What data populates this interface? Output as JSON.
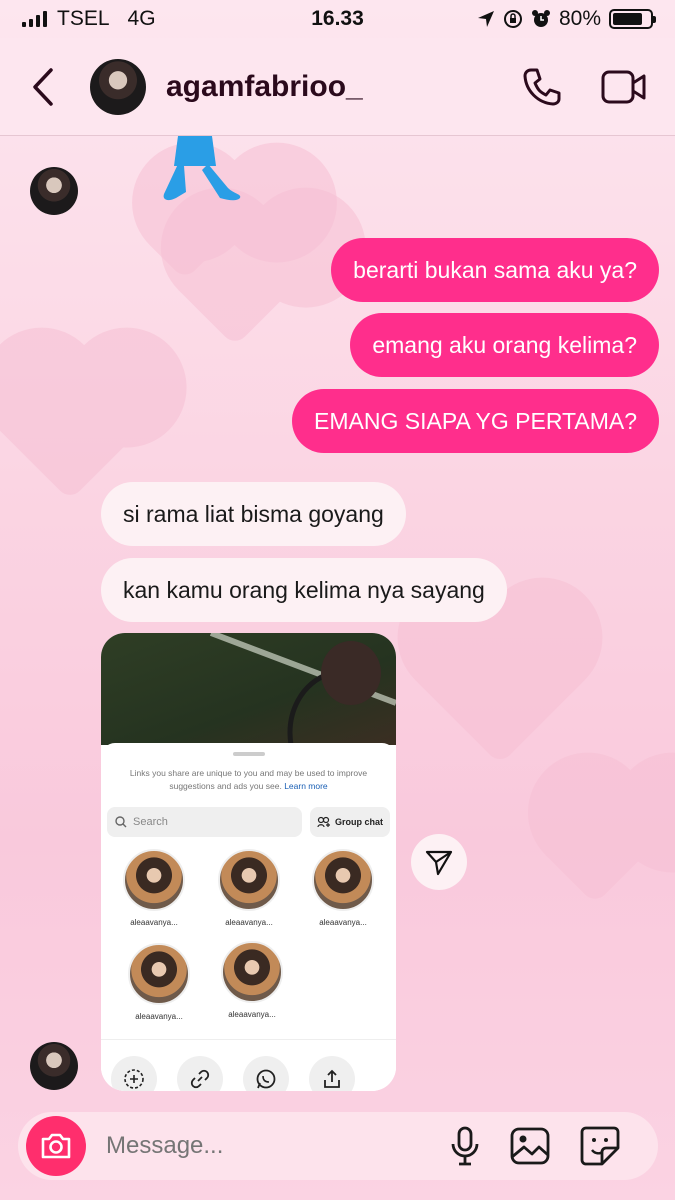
{
  "status_bar": {
    "carrier": "TSEL",
    "network": "4G",
    "time": "16.33",
    "battery": "80%",
    "battery_level": 0.8
  },
  "header": {
    "username": "agamfabrioo_",
    "icons": [
      "back-chevron-icon",
      "phone-icon",
      "video-camera-icon"
    ]
  },
  "messages": [
    {
      "from": "me",
      "text": "berarti bukan sama aku ya?"
    },
    {
      "from": "me",
      "text": "emang aku orang kelima?"
    },
    {
      "from": "me",
      "text": "EMANG SIAPA YG PERTAMA?"
    },
    {
      "from": "them",
      "text": "si rama liat bisma goyang"
    },
    {
      "from": "them",
      "text": "kan kamu orang kelima nya sayang"
    }
  ],
  "shared_post": {
    "note": "Links you share are unique to you and may be used to improve suggestions and ads you see.",
    "learn_more": "Learn more",
    "search_placeholder": "Search",
    "group_chat_label": "Group chat",
    "contacts": [
      {
        "name": "aleaavanya..."
      },
      {
        "name": "aleaavanya..."
      },
      {
        "name": "aleaavanya..."
      },
      {
        "name": "aleaavanya..."
      },
      {
        "name": "aleaavanya..."
      }
    ],
    "action_icons": [
      "add-story-icon",
      "link-icon",
      "whatsapp-icon",
      "share-icon"
    ]
  },
  "composer": {
    "placeholder": "Message...",
    "icons": [
      "camera-icon",
      "microphone-icon",
      "gallery-icon",
      "sticker-icon"
    ]
  },
  "colors": {
    "sent_bubble": "#ff2e8c",
    "received_bubble": "#fdf1f4",
    "camera_button": "#ff2e6d",
    "background": "#fbd5e3"
  }
}
